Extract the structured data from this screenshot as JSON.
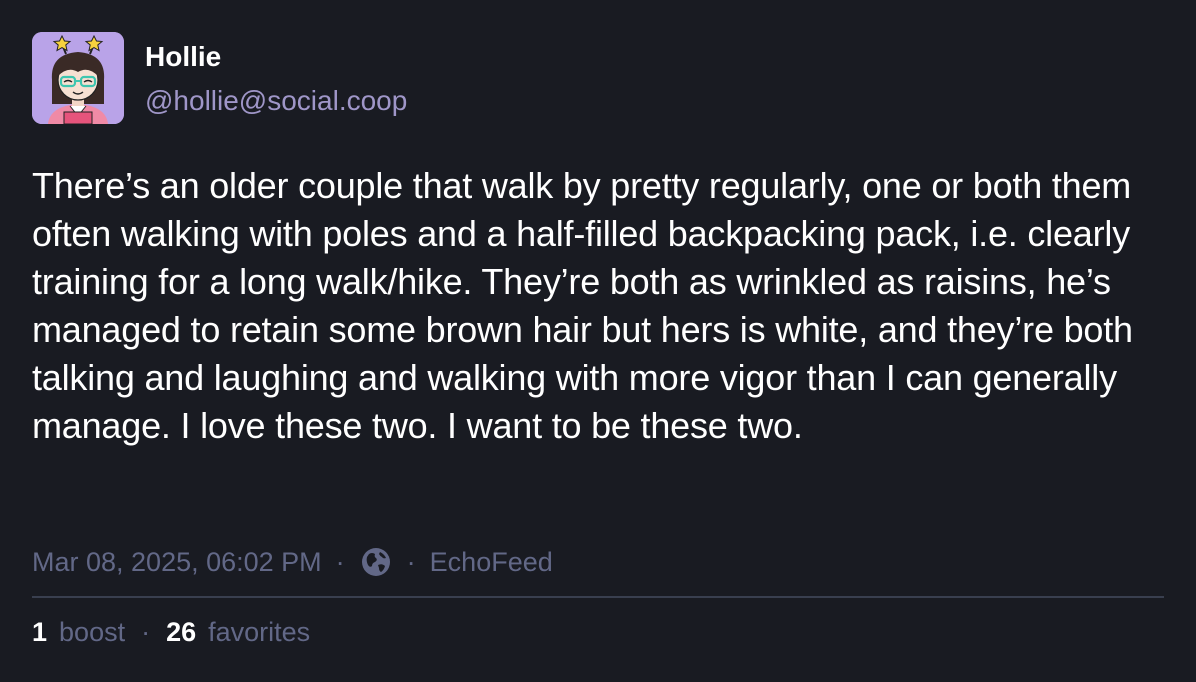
{
  "author": {
    "display_name": "Hollie",
    "handle": "@hollie@social.coop",
    "avatar": "cartoon-avatar-glasses-star-headband"
  },
  "post": {
    "content": "There’s an older couple that walk by pretty regularly, one or both them often walking with poles and a half-filled backpacking pack, i.e. clearly training for a long walk/hike. They’re both as wrinkled as raisins, he’s managed to retain some brown hair but hers is white, and they’re both talking and laughing and walking with more vigor than I can generally manage. I love these two. I want to be these two."
  },
  "meta": {
    "timestamp": "Mar 08, 2025, 06:02 PM",
    "separator": "·",
    "visibility_icon": "globe-icon",
    "app_name": "EchoFeed"
  },
  "stats": {
    "boost_count": "1",
    "boost_label": "boost",
    "favorite_count": "26",
    "favorite_label": "favorites",
    "separator": "·"
  },
  "colors": {
    "background": "#191b22",
    "text": "#ffffff",
    "handle": "#9f96c8",
    "muted": "#626887",
    "divider": "#393f4f",
    "avatar_bg": "#b9a3e8"
  }
}
